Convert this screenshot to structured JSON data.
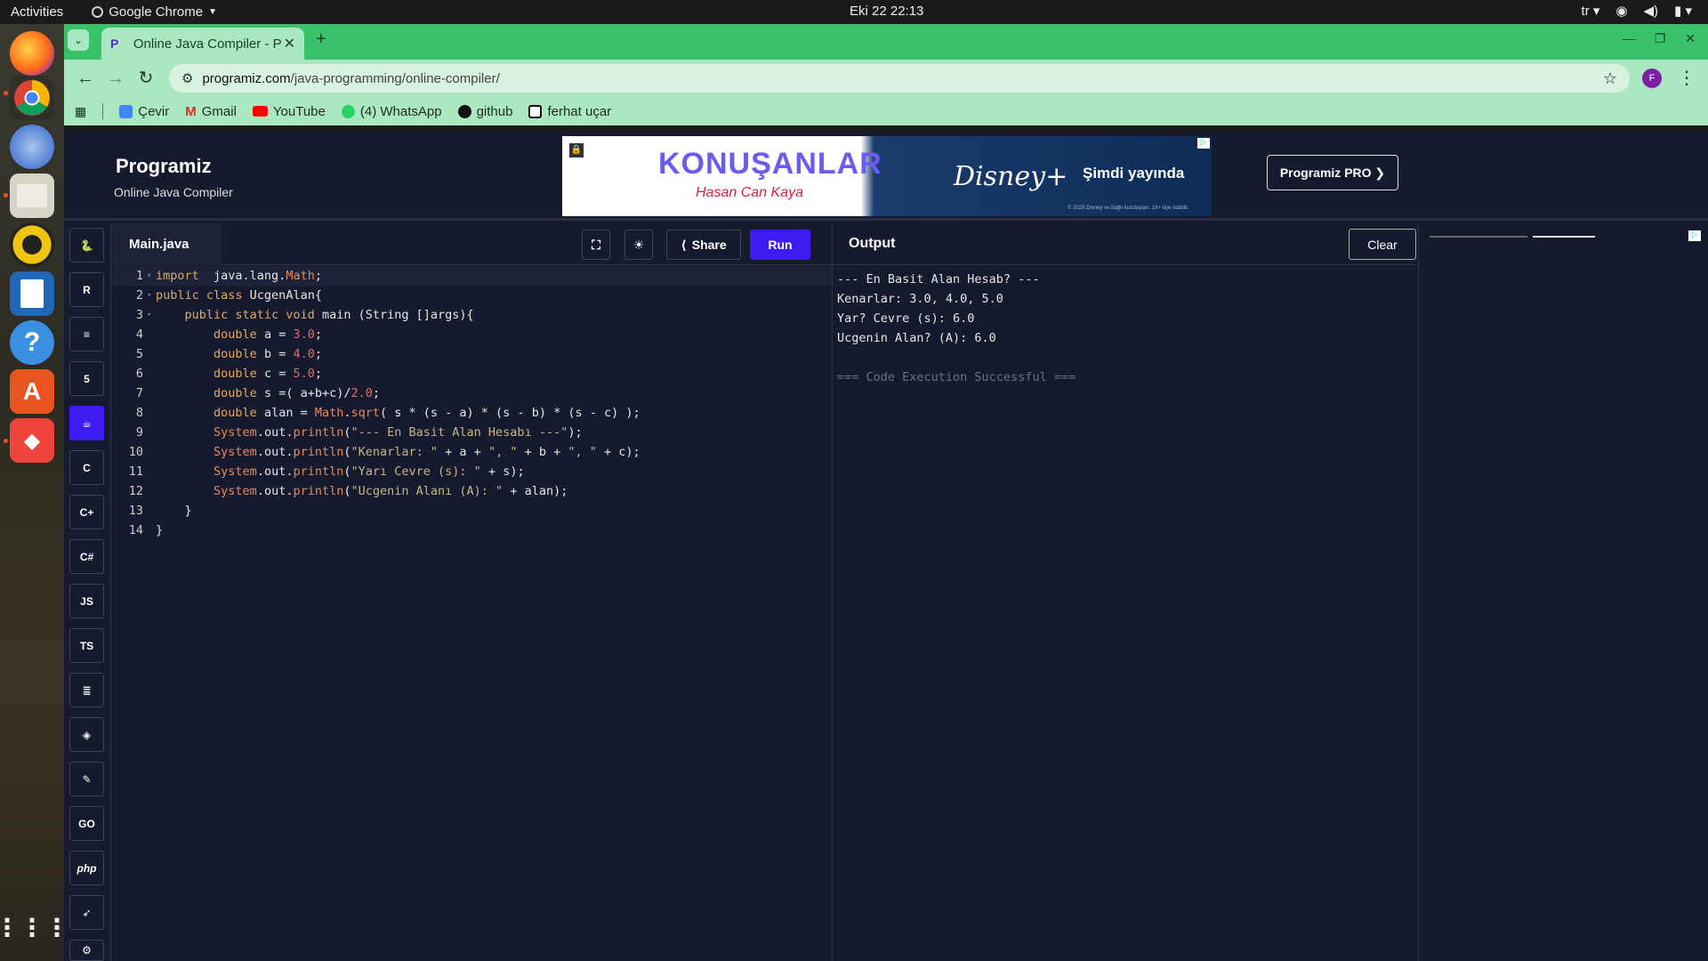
{
  "topbar": {
    "activities": "Activities",
    "app": "Google Chrome",
    "clock": "Eki 22  22:13",
    "lang": "tr"
  },
  "chrome": {
    "tab_title": "Online Java Compiler - P",
    "url_host": "programiz.com",
    "url_path": "/java-programming/online-compiler/",
    "profile_letter": "F",
    "bookmarks": [
      "Çevir",
      "Gmail",
      "YouTube",
      "(4) WhatsApp",
      "github",
      "ferhat uçar"
    ]
  },
  "header": {
    "logo": "Programiz",
    "subtitle": "Online Java Compiler",
    "pro": "Programiz PRO ❯"
  },
  "ad": {
    "title": "KONUŞANLAR",
    "subtitle": "Hasan Can Kaya",
    "brand": "Disney+",
    "cta": "Şimdi yayında",
    "fine": "© 2025 Disney ve bağlı kuruluşları. 18+ üye olabilir."
  },
  "editor": {
    "file": "Main.java",
    "share": "Share",
    "run": "Run"
  },
  "code": [
    [
      [
        "kw",
        "import"
      ],
      [
        "pl",
        "  java.lang."
      ],
      [
        "fn",
        "Math"
      ],
      [
        "pl",
        ";"
      ]
    ],
    [
      [
        "kw",
        "public class"
      ],
      [
        "pl",
        " UcgenAlan{"
      ]
    ],
    [
      [
        "pl",
        "    "
      ],
      [
        "kw",
        "public static void"
      ],
      [
        "pl",
        " main (String []args){"
      ]
    ],
    [
      [
        "pl",
        "        "
      ],
      [
        "kw",
        "double"
      ],
      [
        "pl",
        " a = "
      ],
      [
        "num",
        "3.0"
      ],
      [
        "pl",
        ";"
      ]
    ],
    [
      [
        "pl",
        "        "
      ],
      [
        "kw",
        "double"
      ],
      [
        "pl",
        " b = "
      ],
      [
        "num",
        "4.0"
      ],
      [
        "pl",
        ";"
      ]
    ],
    [
      [
        "pl",
        "        "
      ],
      [
        "kw",
        "double"
      ],
      [
        "pl",
        " c = "
      ],
      [
        "num",
        "5.0"
      ],
      [
        "pl",
        ";"
      ]
    ],
    [
      [
        "pl",
        "        "
      ],
      [
        "kw",
        "double"
      ],
      [
        "pl",
        " s =( a+b+c)/"
      ],
      [
        "num",
        "2.0"
      ],
      [
        "pl",
        ";"
      ]
    ],
    [
      [
        "pl",
        "        "
      ],
      [
        "kw",
        "double"
      ],
      [
        "pl",
        " alan = "
      ],
      [
        "fn",
        "Math"
      ],
      [
        "pl",
        "."
      ],
      [
        "fn",
        "sqrt"
      ],
      [
        "pl",
        "( s * (s - a) * (s - b) * (s - c) );"
      ]
    ],
    [
      [
        "pl",
        "        "
      ],
      [
        "fn",
        "System"
      ],
      [
        "pl",
        ".out."
      ],
      [
        "fn",
        "println"
      ],
      [
        "pl",
        "("
      ],
      [
        "str",
        "\"--- En Basit Alan Hesabı ---\""
      ],
      [
        "pl",
        ");"
      ]
    ],
    [
      [
        "pl",
        "        "
      ],
      [
        "fn",
        "System"
      ],
      [
        "pl",
        ".out."
      ],
      [
        "fn",
        "println"
      ],
      [
        "pl",
        "("
      ],
      [
        "str",
        "\"Kenarlar: \""
      ],
      [
        "pl",
        " + a + "
      ],
      [
        "str",
        "\", \""
      ],
      [
        "pl",
        " + b + "
      ],
      [
        "str",
        "\", \""
      ],
      [
        "pl",
        " + c);"
      ]
    ],
    [
      [
        "pl",
        "        "
      ],
      [
        "fn",
        "System"
      ],
      [
        "pl",
        ".out."
      ],
      [
        "fn",
        "println"
      ],
      [
        "pl",
        "("
      ],
      [
        "str",
        "\"Yarı Cevre (s): \""
      ],
      [
        "pl",
        " + s);"
      ]
    ],
    [
      [
        "pl",
        "        "
      ],
      [
        "fn",
        "System"
      ],
      [
        "pl",
        ".out."
      ],
      [
        "fn",
        "println"
      ],
      [
        "pl",
        "("
      ],
      [
        "str",
        "\"Ucgenin Alanı (A): \""
      ],
      [
        "pl",
        " + alan);"
      ]
    ],
    [
      [
        "pl",
        "    }"
      ]
    ],
    [
      [
        "pl",
        "}"
      ]
    ]
  ],
  "output": {
    "title": "Output",
    "clear": "Clear",
    "lines": [
      "--- En Basit Alan Hesab? ---",
      "Kenarlar: 3.0, 4.0, 5.0",
      "Yar? Cevre (s): 6.0",
      "Ucgenin Alan? (A): 6.0",
      "",
      "=== Code Execution Successful ==="
    ]
  },
  "langs": [
    "python-icon",
    "r-icon",
    "sql-icon",
    "html-icon",
    "java-icon",
    "c-icon",
    "cpp-icon",
    "csharp-icon",
    "JS",
    "TS",
    "go-icon",
    "kotlin-icon",
    "swift-icon",
    "rust-icon",
    "GO",
    "php",
    "swift2-icon",
    "ruby-icon"
  ]
}
